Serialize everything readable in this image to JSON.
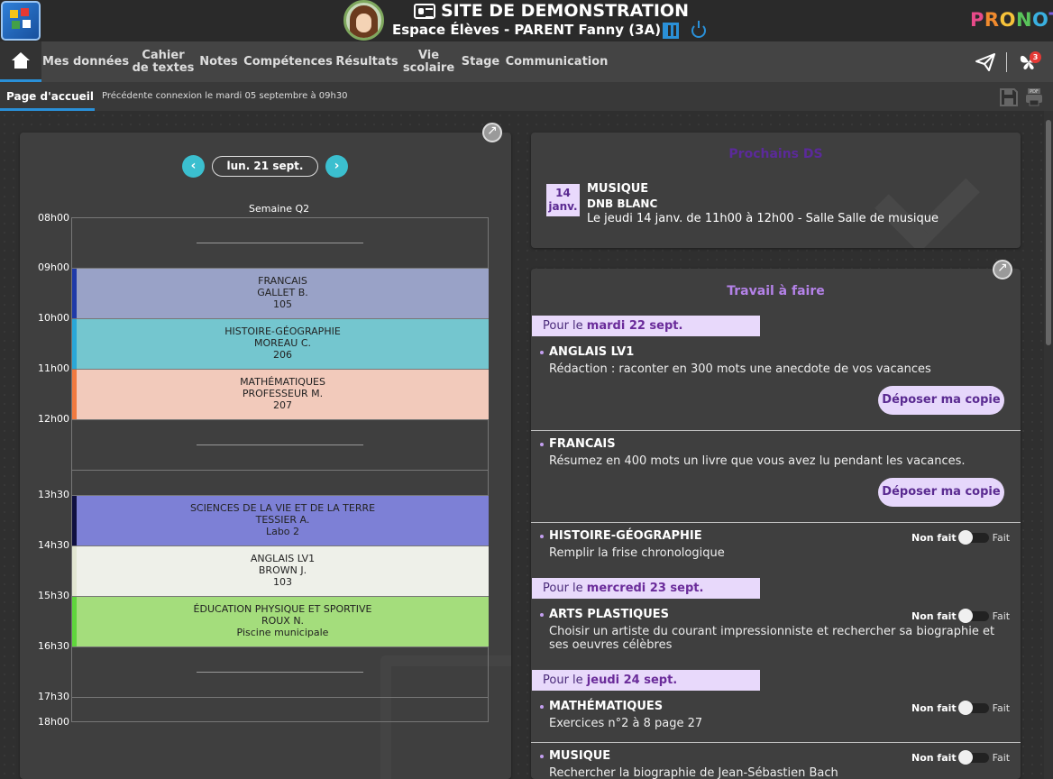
{
  "header": {
    "site_title": "SITE DE DEMONSTRATION",
    "space": "Espace Élèves - PARENT Fanny (3A)",
    "brand": "PRONOTE"
  },
  "nav": {
    "items": [
      {
        "label": "Mes données"
      },
      {
        "label": "Cahier\nde textes"
      },
      {
        "label": "Notes"
      },
      {
        "label": "Compétences"
      },
      {
        "label": "Résultats"
      },
      {
        "label": "Vie\nscolaire"
      },
      {
        "label": "Stage"
      },
      {
        "label": "Communication"
      }
    ],
    "notif_count": "3"
  },
  "subnav": {
    "tab": "Page d'accueil",
    "previous_connection": "Précédente connexion le mardi 05 septembre à 09h30"
  },
  "schedule": {
    "date": "lun. 21 sept.",
    "week": "Semaine Q2",
    "times": [
      "08h00",
      "09h00",
      "10h00",
      "11h00",
      "12h00",
      "13h30",
      "14h30",
      "15h30",
      "16h30",
      "17h30",
      "18h00"
    ],
    "courses": [
      {
        "subject": "FRANCAIS",
        "teacher": "GALLET B.",
        "room": "105",
        "color": "#99a2c7",
        "border": "#1f3aa8"
      },
      {
        "subject": "HISTOIRE-GÉOGRAPHIE",
        "teacher": "MOREAU C.",
        "room": "206",
        "color": "#74c6cf",
        "border": "#2aa7d8"
      },
      {
        "subject": "MATHÉMATIQUES",
        "teacher": "PROFESSEUR M.",
        "room": "207",
        "color": "#f2cabb",
        "border": "#f07a3f"
      },
      {
        "subject": "SCIENCES DE LA VIE ET DE LA TERRE",
        "teacher": "TESSIER A.",
        "room": "Labo 2",
        "color": "#7d80d6",
        "border": "#101040"
      },
      {
        "subject": "ANGLAIS LV1",
        "teacher": "BROWN J.",
        "room": "103",
        "color": "#eef0e9",
        "border": "#e2e6d2"
      },
      {
        "subject": "ÉDUCATION PHYSIQUE ET SPORTIVE",
        "teacher": "ROUX N.",
        "room": "Piscine municipale",
        "color": "#a4dd7c",
        "border": "#5fd63c"
      }
    ]
  },
  "ds": {
    "title": "Prochains DS",
    "date_day": "14",
    "date_month": "janv.",
    "subject": "MUSIQUE",
    "type": "DNB BLANC",
    "detail": "Le jeudi 14 janv. de 11h00 à 12h00  - Salle Salle de musique"
  },
  "homework": {
    "title": "Travail à faire",
    "prefix": "Pour le",
    "days": [
      "mardi 22 sept.",
      "mercredi 23 sept.",
      "jeudi 24 sept."
    ],
    "deposit_label": "Déposer ma copie",
    "not_done": "Non fait",
    "done": "Fait",
    "items": [
      {
        "subject": "ANGLAIS LV1",
        "desc": "Rédaction : raconter en 300 mots une anecdote de vos vacances"
      },
      {
        "subject": "FRANCAIS",
        "desc": "Résumez en 400 mots un livre que vous avez lu pendant les vacances."
      },
      {
        "subject": "HISTOIRE-GÉOGRAPHIE",
        "desc": "Remplir la frise chronologique"
      },
      {
        "subject": "ARTS PLASTIQUES",
        "desc": "Choisir un artiste du courant impressionniste et rechercher sa biographie et ses oeuvres célèbres"
      },
      {
        "subject": "MATHÉMATIQUES",
        "desc": "Exercices n°2 à 8 page 27"
      },
      {
        "subject": "MUSIQUE",
        "desc": "Rechercher la biographie de Jean-Sébastien Bach"
      }
    ]
  },
  "colors": {
    "accent": "#2a90d8",
    "purple": "#9b5de5",
    "cyan": "#3bbfcf"
  }
}
